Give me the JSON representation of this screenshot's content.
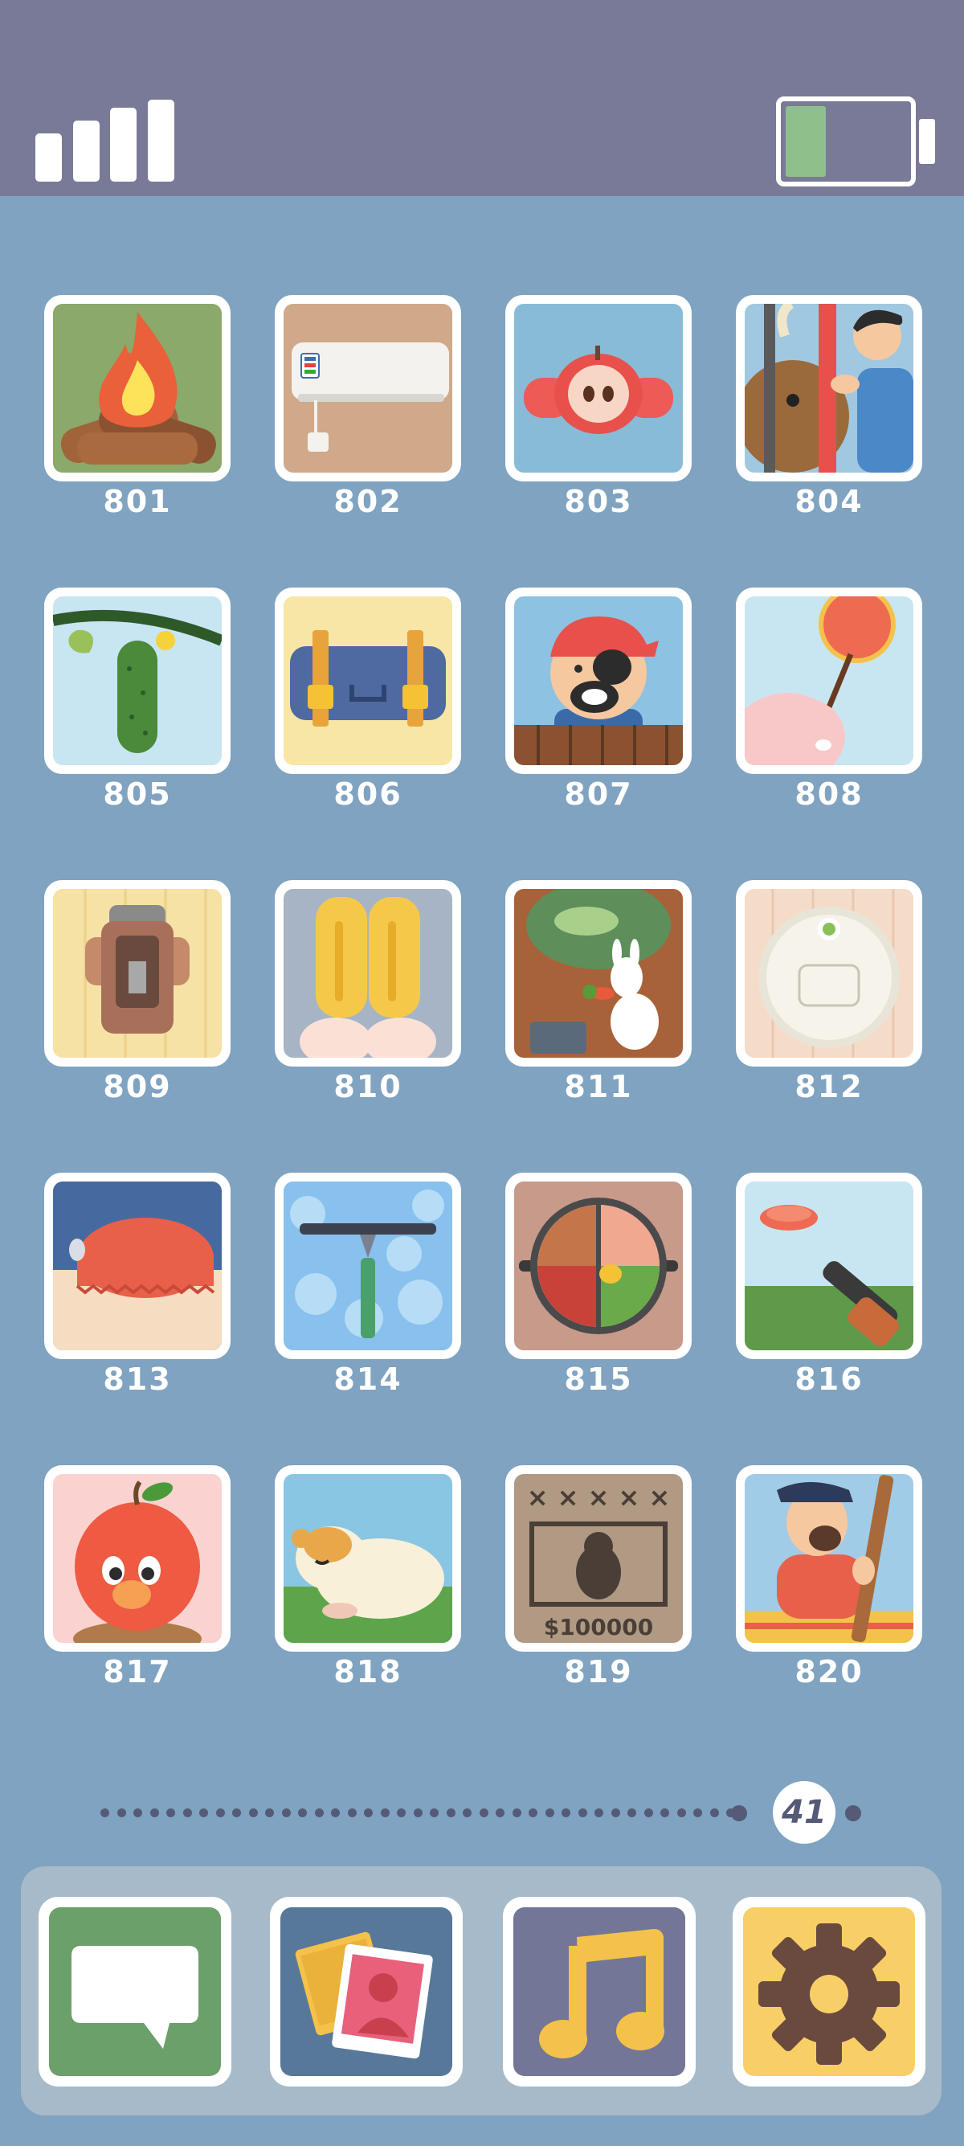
{
  "status_bar": {
    "signal_bars": 4,
    "battery_level": 0.33,
    "battery_color": "#8fbf8a"
  },
  "levels": [
    {
      "number": "801",
      "icon": "campfire"
    },
    {
      "number": "802",
      "icon": "air-conditioner"
    },
    {
      "number": "803",
      "icon": "apple-with-earmuffs"
    },
    {
      "number": "804",
      "icon": "bull-behind-bars"
    },
    {
      "number": "805",
      "icon": "cucumber-on-vine"
    },
    {
      "number": "806",
      "icon": "suitcase"
    },
    {
      "number": "807",
      "icon": "pirate"
    },
    {
      "number": "808",
      "icon": "hand-with-balloon"
    },
    {
      "number": "809",
      "icon": "vending-box"
    },
    {
      "number": "810",
      "icon": "popsicles"
    },
    {
      "number": "811",
      "icon": "bunny-in-hole"
    },
    {
      "number": "812",
      "icon": "robot-vacuum"
    },
    {
      "number": "813",
      "icon": "jar-lid"
    },
    {
      "number": "814",
      "icon": "window-squeegee"
    },
    {
      "number": "815",
      "icon": "hot-pot"
    },
    {
      "number": "816",
      "icon": "clay-pigeon-shotgun"
    },
    {
      "number": "817",
      "icon": "apple-mole"
    },
    {
      "number": "818",
      "icon": "sleeping-hamster"
    },
    {
      "number": "819",
      "icon": "wanted-poster"
    },
    {
      "number": "820",
      "icon": "sailor-at-mast"
    }
  ],
  "pager": {
    "current_page": "41",
    "dot_color": "#555a77"
  },
  "dock": [
    {
      "icon": "speech-bubble-icon",
      "bg": "#6ca06a"
    },
    {
      "icon": "photos-icon",
      "bg": "#58789a"
    },
    {
      "icon": "music-note-icon",
      "bg": "#747697"
    },
    {
      "icon": "settings-gear-icon",
      "bg": "#f8cf66"
    }
  ]
}
